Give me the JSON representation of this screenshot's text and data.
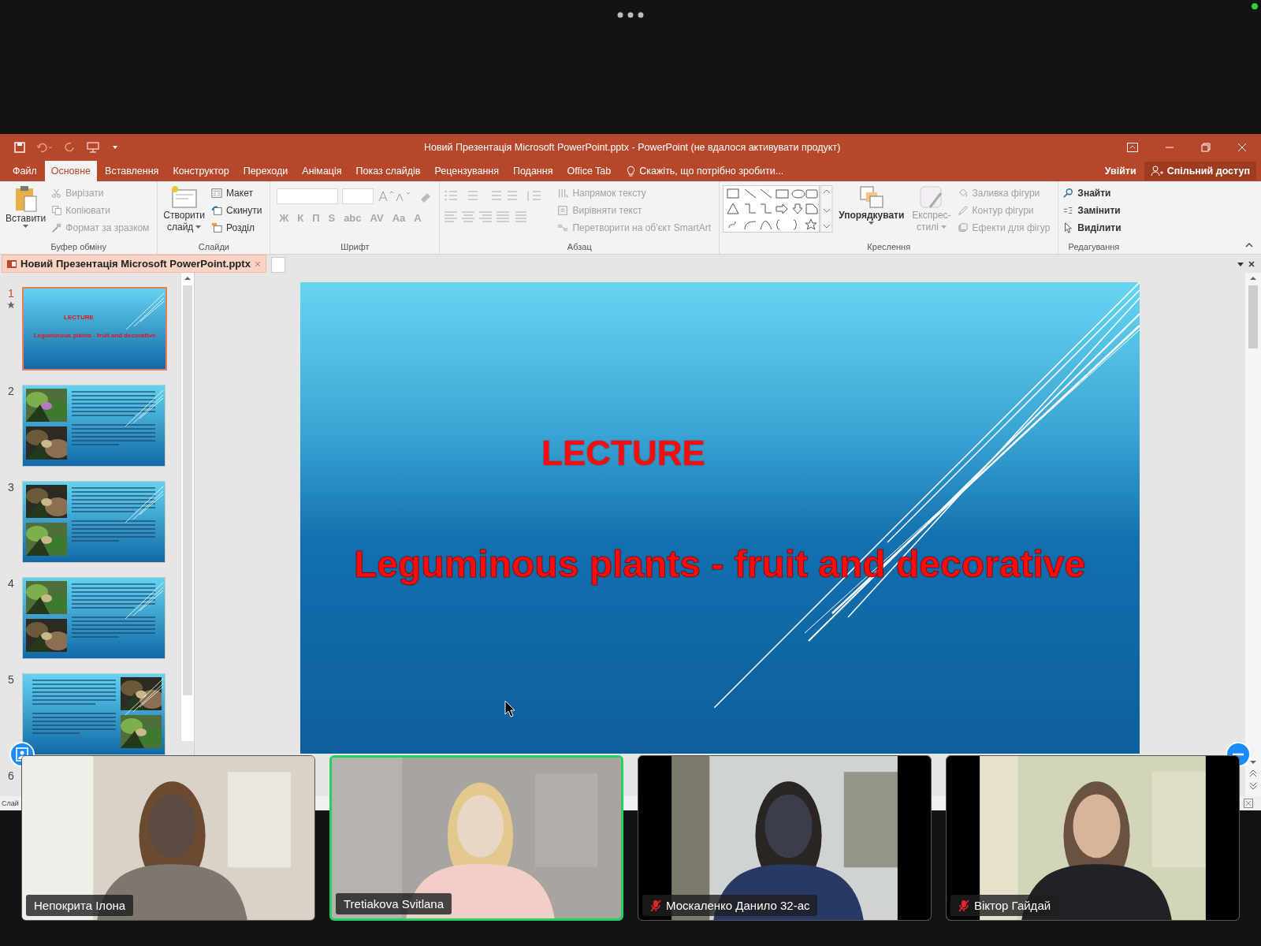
{
  "window": {
    "title": "Новий Презентація Microsoft PowerPoint.pptx - PowerPoint (не вдалося активувати продукт)"
  },
  "tabs": [
    {
      "label": "Файл",
      "selected": false
    },
    {
      "label": "Основне",
      "selected": true
    },
    {
      "label": "Вставлення",
      "selected": false
    },
    {
      "label": "Конструктор",
      "selected": false
    },
    {
      "label": "Переходи",
      "selected": false
    },
    {
      "label": "Анімація",
      "selected": false
    },
    {
      "label": "Показ слайдів",
      "selected": false
    },
    {
      "label": "Рецензування",
      "selected": false
    },
    {
      "label": "Подання",
      "selected": false
    },
    {
      "label": "Office Tab",
      "selected": false
    }
  ],
  "tell_me": "Скажіть, що потрібно зробити...",
  "sign_in": "Увійти",
  "share": "Спільний доступ",
  "ribbon": {
    "clipboard": {
      "label": "Буфер обміну",
      "paste": "Вставити",
      "items": [
        {
          "label": "Вирізати",
          "disabled": true
        },
        {
          "label": "Копіювати",
          "disabled": true
        },
        {
          "label": "Формат за зразком",
          "disabled": true
        }
      ]
    },
    "slides": {
      "label": "Слайди",
      "new_slide": [
        "Створити",
        "слайд"
      ],
      "items": [
        {
          "label": "Макет",
          "disabled": false
        },
        {
          "label": "Скинути",
          "disabled": false
        },
        {
          "label": "Розділ",
          "disabled": false
        }
      ]
    },
    "font": {
      "label": "Шрифт",
      "buttons": [
        "Ж",
        "К",
        "П",
        "S",
        "abc",
        "AV",
        "Aa",
        "A"
      ]
    },
    "paragraph": {
      "label": "Абзац",
      "items": [
        {
          "label": "Напрямок тексту",
          "disabled": true
        },
        {
          "label": "Вирівняти текст",
          "disabled": true
        },
        {
          "label": "Перетворити на об'єкт SmartArt",
          "disabled": true
        }
      ]
    },
    "drawing": {
      "label": "Креслення",
      "arrange": "Упорядкувати",
      "quick_styles": [
        "Експрес-",
        "стилі"
      ],
      "items": [
        {
          "label": "Заливка фігури",
          "disabled": true
        },
        {
          "label": "Контур фігури",
          "disabled": true
        },
        {
          "label": "Ефекти для фігур",
          "disabled": true
        }
      ]
    },
    "editing": {
      "label": "Редагування",
      "items": [
        {
          "label": "Знайти",
          "disabled": false
        },
        {
          "label": "Замінити",
          "disabled": false
        },
        {
          "label": "Виділити",
          "disabled": false
        }
      ]
    }
  },
  "document_tab": "Новий Презентація Microsoft PowerPoint.pptx",
  "thumbnails": [
    {
      "number": "1",
      "selected": true,
      "kind": "title",
      "title": "LECTURE",
      "subtitle": "Leguminous plants - fruit and decorative"
    },
    {
      "number": "2",
      "selected": false,
      "kind": "photos-left"
    },
    {
      "number": "3",
      "selected": false,
      "kind": "photos-left"
    },
    {
      "number": "4",
      "selected": false,
      "kind": "photos-left"
    },
    {
      "number": "5",
      "selected": false,
      "kind": "photos-right"
    },
    {
      "number": "6",
      "selected": false
    }
  ],
  "slide": {
    "title": "LECTURE",
    "subtitle": "Leguminous plants - fruit and decorative"
  },
  "status_bar": "Слай",
  "participants": [
    {
      "name": "Непокрита Ілона",
      "muted": false,
      "speaking": false
    },
    {
      "name": "Tretiakova Svitlana",
      "muted": false,
      "speaking": true
    },
    {
      "name": "Москаленко Данило 32-ас",
      "muted": true,
      "speaking": false
    },
    {
      "name": "Віктор Гайдай",
      "muted": true,
      "speaking": false
    }
  ]
}
